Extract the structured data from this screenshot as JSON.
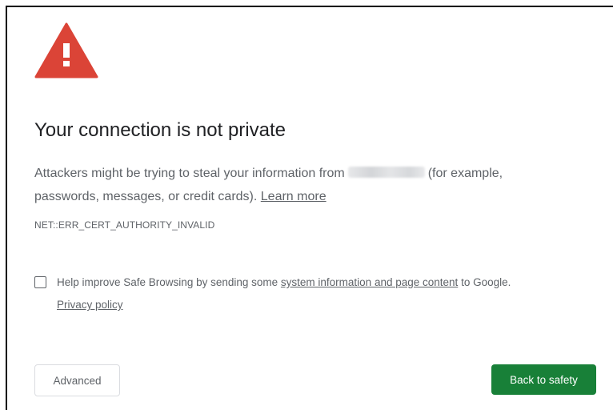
{
  "page": {
    "background_color": "#ffffff",
    "frame_color": "#000000"
  },
  "icon": {
    "name": "warning-triangle-icon",
    "fill_color": "#db4437",
    "glyph_color": "#ffffff"
  },
  "heading": {
    "title": "Your connection is not private"
  },
  "message": {
    "text_before": "Attackers might be trying to steal your information from",
    "text_after": "(for example,",
    "line2_text": "passwords, messages, or credit cards).",
    "learn_more_link": "Learn more"
  },
  "error_code": "NET::ERR_CERT_AUTHORITY_INVALID",
  "safe_browsing": {
    "checked": false,
    "text_before": "Help improve Safe Browsing by sending some",
    "link_text": "system information and page content",
    "text_after": "to Google.",
    "privacy_link": "Privacy policy"
  },
  "buttons": {
    "advanced_label": "Advanced",
    "back_to_safety_label": "Back to safety",
    "primary_color": "#188038"
  }
}
